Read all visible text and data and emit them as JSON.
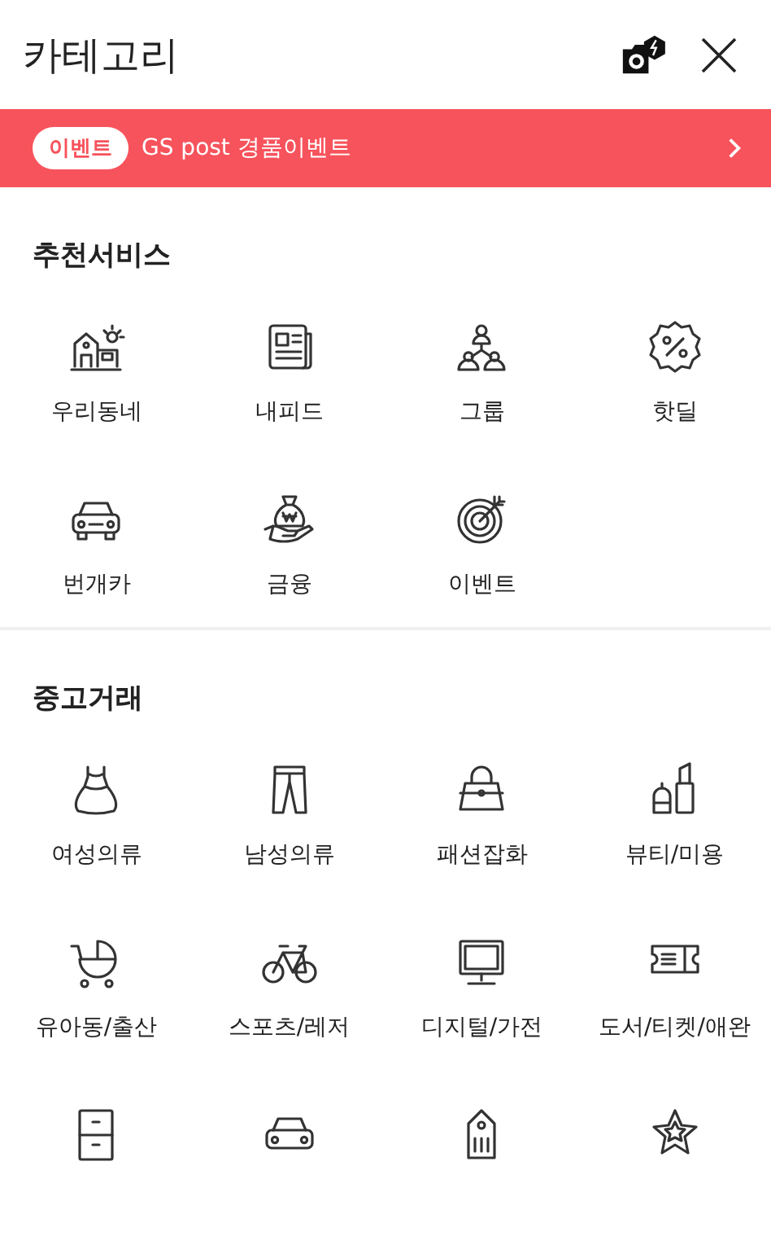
{
  "header": {
    "title": "카테고리"
  },
  "banner": {
    "badge": "이벤트",
    "text": "GS post 경품이벤트"
  },
  "sections": [
    {
      "title": "추천서비스",
      "clipped_row": false,
      "items": [
        {
          "label": "우리동네"
        },
        {
          "label": "내피드"
        },
        {
          "label": "그룹"
        },
        {
          "label": "핫딜"
        },
        {
          "label": "번개카"
        },
        {
          "label": "금융"
        },
        {
          "label": "이벤트"
        }
      ]
    },
    {
      "title": "중고거래",
      "clipped_row": true,
      "items": [
        {
          "label": "여성의류"
        },
        {
          "label": "남성의류"
        },
        {
          "label": "패션잡화"
        },
        {
          "label": "뷰티/미용"
        },
        {
          "label": "유아동/출산"
        },
        {
          "label": "스포츠/레저"
        },
        {
          "label": "디지털/가전"
        },
        {
          "label": "도서/티켓/애완"
        }
      ]
    }
  ]
}
